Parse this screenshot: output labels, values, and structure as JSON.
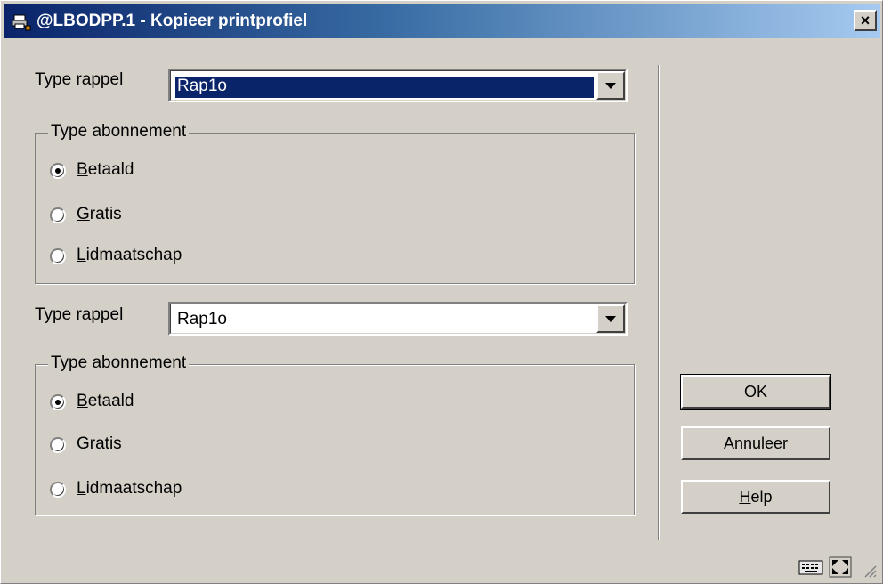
{
  "window": {
    "title": "@LBODPP.1 - Kopieer printprofiel",
    "close_glyph": "×"
  },
  "section1": {
    "type_label": "Type rappel",
    "type_value": "Rap1o",
    "group_title": "Type abonnement",
    "options": [
      {
        "key": "B",
        "rest": "etaald",
        "checked": true
      },
      {
        "key": "G",
        "rest": "ratis",
        "checked": false
      },
      {
        "key": "L",
        "rest": "idmaatschap",
        "checked": false
      }
    ]
  },
  "section2": {
    "type_label": "Type rappel",
    "type_value": "Rap1o",
    "group_title": "Type abonnement",
    "options": [
      {
        "key": "B",
        "rest": "etaald",
        "checked": true
      },
      {
        "key": "G",
        "rest": "ratis",
        "checked": false
      },
      {
        "key": "L",
        "rest": "idmaatschap",
        "checked": false
      }
    ]
  },
  "buttons": {
    "ok": "OK",
    "cancel": "Annuleer",
    "help_key": "H",
    "help_rest": "elp"
  },
  "icons": {
    "title": "printer-network-icon",
    "status": [
      "keyboard-icon",
      "resize-icon"
    ]
  }
}
